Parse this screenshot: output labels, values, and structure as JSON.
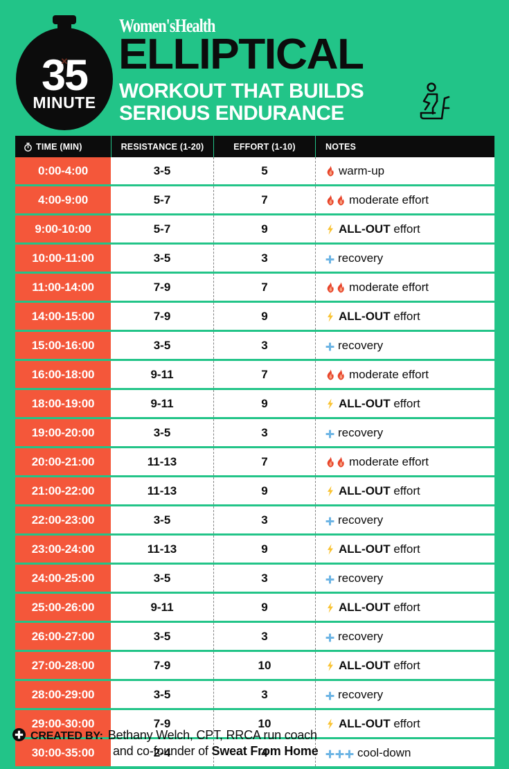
{
  "colors": {
    "background_green": "#22c488",
    "time_cell_orange": "#f4573a",
    "header_black": "#0c0c0c",
    "row_white": "#ffffff",
    "flame_red": "#e8442a",
    "bolt_yellow": "#f9c230",
    "cross_blue": "#6cb4e4"
  },
  "header": {
    "badge": {
      "number": "35",
      "unit": "MINUTE",
      "icon": "stopwatch-badge"
    },
    "brand": "Women'sHealth",
    "title": "ELLIPTICAL",
    "subtitle_line_1": "WORKOUT THAT BUILDS",
    "subtitle_line_2": "SERIOUS ENDURANCE",
    "machine_icon": "elliptical-machine-icon"
  },
  "table": {
    "columns": [
      {
        "label": "TIME (MIN)",
        "icon": "stopwatch-icon"
      },
      {
        "label": "RESISTANCE (1-20)",
        "icon": null
      },
      {
        "label": "EFFORT (1-10)",
        "icon": null
      },
      {
        "label": "NOTES",
        "icon": null
      }
    ],
    "rows": [
      {
        "time": "0:00-4:00",
        "resistance": "3-5",
        "effort": "5",
        "icons": [
          "flame"
        ],
        "note_strong": "",
        "note": "warm-up"
      },
      {
        "time": "4:00-9:00",
        "resistance": "5-7",
        "effort": "7",
        "icons": [
          "flame",
          "flame"
        ],
        "note_strong": "",
        "note": "moderate effort"
      },
      {
        "time": "9:00-10:00",
        "resistance": "5-7",
        "effort": "9",
        "icons": [
          "bolt"
        ],
        "note_strong": "ALL-OUT",
        "note": " effort"
      },
      {
        "time": "10:00-11:00",
        "resistance": "3-5",
        "effort": "3",
        "icons": [
          "cross"
        ],
        "note_strong": "",
        "note": "recovery"
      },
      {
        "time": "11:00-14:00",
        "resistance": "7-9",
        "effort": "7",
        "icons": [
          "flame",
          "flame"
        ],
        "note_strong": "",
        "note": "moderate effort"
      },
      {
        "time": "14:00-15:00",
        "resistance": "7-9",
        "effort": "9",
        "icons": [
          "bolt"
        ],
        "note_strong": "ALL-OUT",
        "note": " effort"
      },
      {
        "time": "15:00-16:00",
        "resistance": "3-5",
        "effort": "3",
        "icons": [
          "cross"
        ],
        "note_strong": "",
        "note": "recovery"
      },
      {
        "time": "16:00-18:00",
        "resistance": "9-11",
        "effort": "7",
        "icons": [
          "flame",
          "flame"
        ],
        "note_strong": "",
        "note": "moderate effort"
      },
      {
        "time": "18:00-19:00",
        "resistance": "9-11",
        "effort": "9",
        "icons": [
          "bolt"
        ],
        "note_strong": "ALL-OUT",
        "note": " effort"
      },
      {
        "time": "19:00-20:00",
        "resistance": "3-5",
        "effort": "3",
        "icons": [
          "cross"
        ],
        "note_strong": "",
        "note": "recovery"
      },
      {
        "time": "20:00-21:00",
        "resistance": "11-13",
        "effort": "7",
        "icons": [
          "flame",
          "flame"
        ],
        "note_strong": "",
        "note": "moderate effort"
      },
      {
        "time": "21:00-22:00",
        "resistance": "11-13",
        "effort": "9",
        "icons": [
          "bolt"
        ],
        "note_strong": "ALL-OUT",
        "note": " effort"
      },
      {
        "time": "22:00-23:00",
        "resistance": "3-5",
        "effort": "3",
        "icons": [
          "cross"
        ],
        "note_strong": "",
        "note": "recovery"
      },
      {
        "time": "23:00-24:00",
        "resistance": "11-13",
        "effort": "9",
        "icons": [
          "bolt"
        ],
        "note_strong": "ALL-OUT",
        "note": " effort"
      },
      {
        "time": "24:00-25:00",
        "resistance": "3-5",
        "effort": "3",
        "icons": [
          "cross"
        ],
        "note_strong": "",
        "note": "recovery"
      },
      {
        "time": "25:00-26:00",
        "resistance": "9-11",
        "effort": "9",
        "icons": [
          "bolt"
        ],
        "note_strong": "ALL-OUT",
        "note": " effort"
      },
      {
        "time": "26:00-27:00",
        "resistance": "3-5",
        "effort": "3",
        "icons": [
          "cross"
        ],
        "note_strong": "",
        "note": "recovery"
      },
      {
        "time": "27:00-28:00",
        "resistance": "7-9",
        "effort": "10",
        "icons": [
          "bolt"
        ],
        "note_strong": "ALL-OUT",
        "note": " effort"
      },
      {
        "time": "28:00-29:00",
        "resistance": "3-5",
        "effort": "3",
        "icons": [
          "cross"
        ],
        "note_strong": "",
        "note": "recovery"
      },
      {
        "time": "29:00-30:00",
        "resistance": "7-9",
        "effort": "10",
        "icons": [
          "bolt"
        ],
        "note_strong": "ALL-OUT",
        "note": " effort"
      },
      {
        "time": "30:00-35:00",
        "resistance": "2-4",
        "effort": "4",
        "icons": [
          "cross",
          "cross",
          "cross"
        ],
        "note_strong": "",
        "note": "cool-down"
      }
    ]
  },
  "footer": {
    "icon": "plus-circle-icon",
    "created_by_label": "CREATED BY:",
    "credit_line_1": "Bethany Welch, CPT, RRCA run coach",
    "credit_line_2_prefix": "and co-founder of ",
    "credit_line_2_business": "Sweat From Home"
  }
}
